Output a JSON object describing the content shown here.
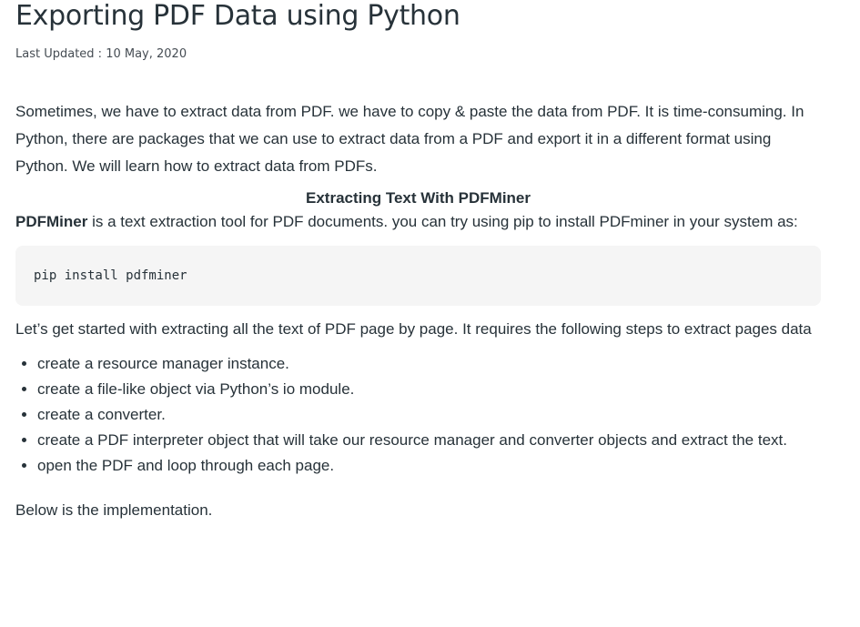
{
  "article": {
    "title": "Exporting PDF Data using Python",
    "last_updated": "Last Updated : 10 May, 2020",
    "intro": "Sometimes, we have to extract data from PDF. we have to copy & paste the data from PDF. It is time-consuming. In Python, there are packages that we can use to extract data from a PDF and export it in a different format using Python. We will learn how to extract data from PDFs.",
    "subheading": "Extracting Text With PDFMiner",
    "tool_name": "PDFMiner",
    "tool_desc": " is a text extraction tool for PDF documents. you can try using pip to install PDFminer in your system as:",
    "code": "pip install pdfminer",
    "lead": "Let’s get started with extracting all the text of PDF page by page. It requires the following steps to extract pages data",
    "steps": [
      "create a resource manager instance.",
      "create a file-like object via Python’s io module.",
      "create a converter.",
      "create a PDF interpreter object that will take our resource manager and converter objects and extract the text.",
      "open the PDF and loop through each page."
    ],
    "outro": "Below is the implementation."
  }
}
